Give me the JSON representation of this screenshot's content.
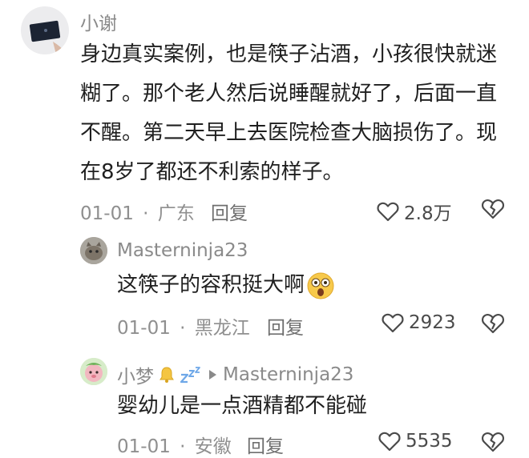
{
  "comments": [
    {
      "user": "小谢",
      "text": "身边真实案例，也是筷子沾酒，小孩很快就迷糊了。那个老人然后说睡醒就好了，后面一直不醒。第二天早上去医院检查大脑损伤了。现在8岁了都还不利索的样子。",
      "date": "01-01",
      "location": "广东",
      "reply_label": "回复",
      "likes": "2.8万"
    },
    {
      "user": "Masterninja23",
      "text": "这筷子的容积挺大啊",
      "date": "01-01",
      "location": "黑龙江",
      "reply_label": "回复",
      "likes": "2923"
    },
    {
      "user": "小梦",
      "reply_to": "Masterninja23",
      "text": "婴幼儿是一点酒精都不能碰",
      "date": "01-01",
      "location": "安徽",
      "reply_label": "回复",
      "likes": "5535"
    }
  ],
  "meta_separator": "·",
  "icons": {
    "like": "heart-outline-icon",
    "dislike": "broken-heart-icon",
    "reply_arrow": "triangle-right-icon",
    "badge_bell": "bell-icon",
    "badge_sleep": "zzz-icon",
    "emoji": "astonished-face-emoji"
  },
  "colors": {
    "name": "#8a8a8a",
    "text": "#1f1f1f",
    "meta": "#8f8f8f"
  }
}
